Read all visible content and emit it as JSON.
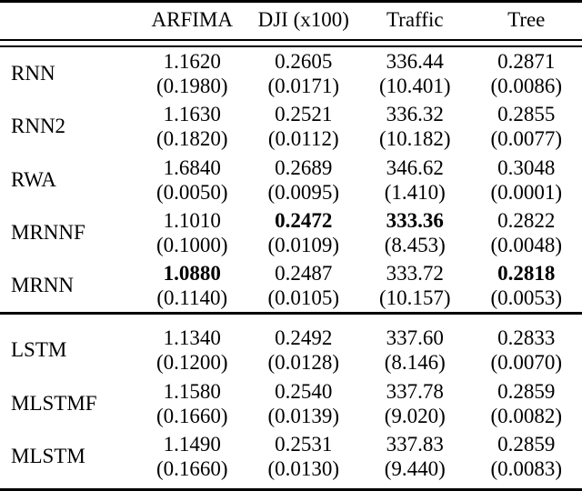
{
  "table": {
    "columns": [
      "",
      "ARFIMA",
      "DJI (x100)",
      "Traffic",
      "Tree"
    ],
    "groups": [
      {
        "name": "rnn-group",
        "rows": [
          {
            "label": "RNN",
            "cells": [
              {
                "mean": "1.1620",
                "std": "(0.1980)",
                "bold": false
              },
              {
                "mean": "0.2605",
                "std": "(0.0171)",
                "bold": false
              },
              {
                "mean": "336.44",
                "std": "(10.401)",
                "bold": false
              },
              {
                "mean": "0.2871",
                "std": "(0.0086)",
                "bold": false
              }
            ]
          },
          {
            "label": "RNN2",
            "cells": [
              {
                "mean": "1.1630",
                "std": "(0.1820)",
                "bold": false
              },
              {
                "mean": "0.2521",
                "std": "(0.0112)",
                "bold": false
              },
              {
                "mean": "336.32",
                "std": "(10.182)",
                "bold": false
              },
              {
                "mean": "0.2855",
                "std": "(0.0077)",
                "bold": false
              }
            ]
          },
          {
            "label": "RWA",
            "cells": [
              {
                "mean": "1.6840",
                "std": "(0.0050)",
                "bold": false
              },
              {
                "mean": "0.2689",
                "std": "(0.0095)",
                "bold": false
              },
              {
                "mean": "346.62",
                "std": "(1.410)",
                "bold": false
              },
              {
                "mean": "0.3048",
                "std": "(0.0001)",
                "bold": false
              }
            ]
          },
          {
            "label": "MRNNF",
            "cells": [
              {
                "mean": "1.1010",
                "std": "(0.1000)",
                "bold": false
              },
              {
                "mean": "0.2472",
                "std": "(0.0109)",
                "bold": true
              },
              {
                "mean": "333.36",
                "std": "(8.453)",
                "bold": true
              },
              {
                "mean": "0.2822",
                "std": "(0.0048)",
                "bold": false
              }
            ]
          },
          {
            "label": "MRNN",
            "cells": [
              {
                "mean": "1.0880",
                "std": "(0.1140)",
                "bold": true
              },
              {
                "mean": "0.2487",
                "std": "(0.0105)",
                "bold": false
              },
              {
                "mean": "333.72",
                "std": "(10.157)",
                "bold": false
              },
              {
                "mean": "0.2818",
                "std": "(0.0053)",
                "bold": true
              }
            ]
          }
        ]
      },
      {
        "name": "lstm-group",
        "rows": [
          {
            "label": "LSTM",
            "cells": [
              {
                "mean": "1.1340",
                "std": "(0.1200)",
                "bold": false
              },
              {
                "mean": "0.2492",
                "std": "(0.0128)",
                "bold": false
              },
              {
                "mean": "337.60",
                "std": "(8.146)",
                "bold": false
              },
              {
                "mean": "0.2833",
                "std": "(0.0070)",
                "bold": false
              }
            ]
          },
          {
            "label": "MLSTMF",
            "cells": [
              {
                "mean": "1.1580",
                "std": "(0.1660)",
                "bold": false
              },
              {
                "mean": "0.2540",
                "std": "(0.0139)",
                "bold": false
              },
              {
                "mean": "337.78",
                "std": "(9.020)",
                "bold": false
              },
              {
                "mean": "0.2859",
                "std": "(0.0082)",
                "bold": false
              }
            ]
          },
          {
            "label": "MLSTM",
            "cells": [
              {
                "mean": "1.1490",
                "std": "(0.1660)",
                "bold": false
              },
              {
                "mean": "0.2531",
                "std": "(0.0130)",
                "bold": false
              },
              {
                "mean": "337.83",
                "std": "(9.440)",
                "bold": false
              },
              {
                "mean": "0.2859",
                "std": "(0.0083)",
                "bold": false
              }
            ]
          }
        ]
      }
    ]
  }
}
